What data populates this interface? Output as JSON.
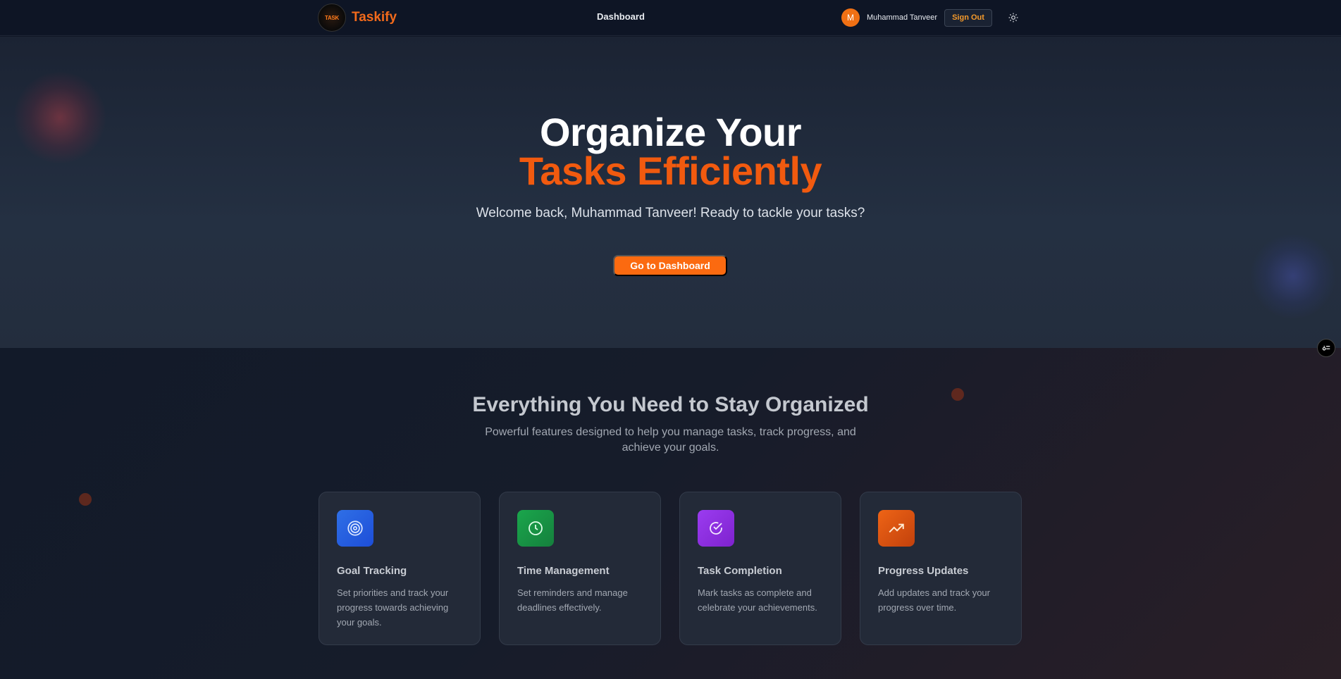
{
  "navbar": {
    "logo_text": "TASK",
    "brand": "Taskify",
    "center_link": "Dashboard",
    "avatar_initial": "M",
    "username": "Muhammad Tanveer",
    "signout_label": "Sign Out",
    "theme_icon": "sun-icon"
  },
  "hero": {
    "title_line1": "Organize Your",
    "title_line2": "Tasks Efficiently",
    "subtitle": "Welcome back, Muhammad Tanveer! Ready to tackle your tasks?",
    "cta_label": "Go to Dashboard",
    "accent_color": "#f15a0f"
  },
  "features": {
    "title": "Everything You Need to Stay Organized",
    "subtitle_line1": "Powerful features designed to help you manage tasks, track progress, and",
    "subtitle_line2": "achieve your goals.",
    "cards": [
      {
        "icon": "target-icon",
        "color": "#2563eb",
        "title": "Goal Tracking",
        "description": "Set priorities and track your progress towards achieving your goals."
      },
      {
        "icon": "clock-icon",
        "color": "#16a34a",
        "title": "Time Management",
        "description": "Set reminders and manage deadlines effectively."
      },
      {
        "icon": "check-circle-icon",
        "color": "#9333ea",
        "title": "Task Completion",
        "description": "Mark tasks as complete and celebrate your achievements."
      },
      {
        "icon": "trending-up-icon",
        "color": "#ea580c",
        "title": "Progress Updates",
        "description": "Add updates and track your progress over time."
      }
    ]
  }
}
